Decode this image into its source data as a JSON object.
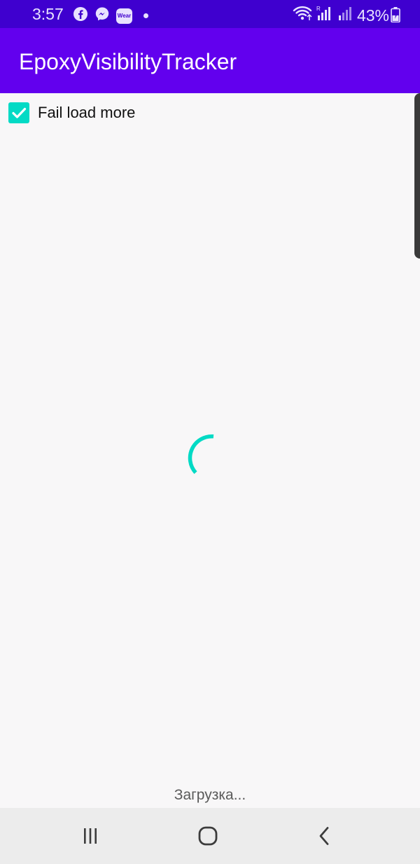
{
  "status_bar": {
    "time": "3:57",
    "notification_icons": [
      "facebook-icon",
      "messenger-icon",
      "wear-icon"
    ],
    "wear_label": "Wear",
    "battery_percent": "43%"
  },
  "app_bar": {
    "title": "EpoxyVisibilityTracker"
  },
  "content": {
    "checkbox": {
      "label": "Fail load more",
      "checked": true
    },
    "loading_text": "Загрузка..."
  },
  "colors": {
    "status_bar": "#3f00cf",
    "app_bar": "#6200ee",
    "accent": "#03dac5",
    "background": "#f8f7f8"
  },
  "nav_bar": {
    "buttons": [
      "recent-apps-icon",
      "home-icon",
      "back-icon"
    ]
  }
}
